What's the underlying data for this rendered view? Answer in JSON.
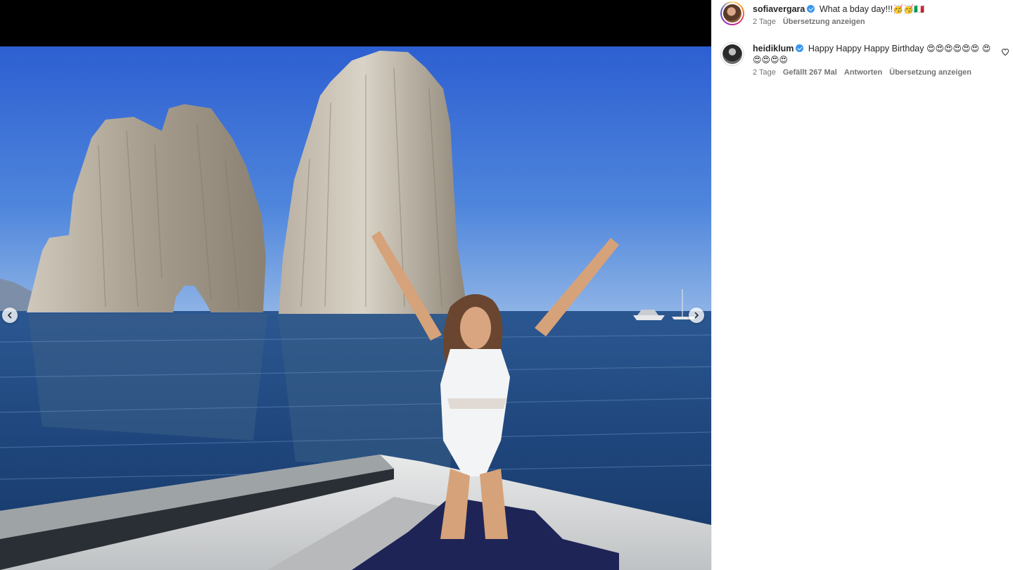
{
  "post": {
    "media_alt": ""
  },
  "comments": [
    {
      "username": "sofiavergara",
      "verified": true,
      "text": "What a bday day!!!",
      "emoji": "🥳🥳🇮🇹",
      "time": "2 Tage",
      "translate": "Übersetzung anzeigen"
    },
    {
      "username": "heidiklum",
      "verified": true,
      "text": "Happy Happy Happy Birthday",
      "emoji": "😍😍😍😍😍😍 😍😍😍😍😍",
      "time": "2 Tage",
      "likes": "Gefällt 267 Mal",
      "reply": "Antworten",
      "translate": "Übersetzung anzeigen"
    }
  ],
  "colors": {
    "sky": "#3f74d8",
    "sea": "#1f4a86",
    "verified": "#3897f0"
  },
  "icons": {
    "prev": "chevron-left-icon",
    "next": "chevron-right-icon",
    "like": "heart-outline-icon",
    "verified": "verified-badge-icon"
  }
}
